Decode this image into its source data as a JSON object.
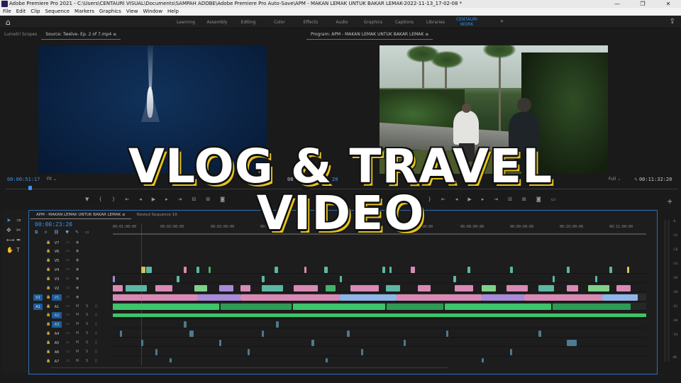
{
  "window": {
    "title": "Adobe Premiere Pro 2021 - C:\\Users\\CENTAURI VISUAL\\Documents\\SAMPAH ADOBE\\Adobe Premiere Pro Auto-Save\\APM - MAKAN LEMAK UNTUK BAKAR LEMAK-2022-11-13_17-02-08 *",
    "controls": [
      "—",
      "❐",
      "✕"
    ]
  },
  "menu": [
    "File",
    "Edit",
    "Clip",
    "Sequence",
    "Markers",
    "Graphics",
    "View",
    "Window",
    "Help"
  ],
  "workspaces": {
    "tabs": [
      "Learning",
      "Assembly",
      "Editing",
      "Color",
      "Effects",
      "Audio",
      "Graphics",
      "Captions",
      "Libraries",
      "CENTAURI WORK"
    ],
    "active": "CENTAURI WORK",
    "more": "»"
  },
  "source_monitor": {
    "tabs": [
      "Lumetri Scopes",
      "Source: Twelve- Ep. 2 of 7.mp4 ≡"
    ],
    "timecode": "00:00:51:17",
    "fit": "Fit",
    "right_tc_fragment": "08"
  },
  "program_monitor": {
    "tab": "Program: APM - MAKAN LEMAK UNTUK BAKAR LEMAK ≡",
    "timecode_fragment": "20",
    "fit": "Full",
    "duration": "00:11:32:20"
  },
  "timeline": {
    "tabs": [
      "APM - MAKAN LEMAK UNTUK BAKAR LEMAK ≡",
      "Nested Sequence 19"
    ],
    "timecode": "00:00:23:20",
    "ruler": [
      "00:01:00:00",
      "00:02:00:00",
      "00:03:00:00",
      "00:04:00:00",
      "00:07:00:00",
      "00:08:00:00",
      "00:09:00:00",
      "00:10:00:00",
      "00:11:00:00"
    ],
    "video_tracks": [
      "V7",
      "V6",
      "V5",
      "V4",
      "V3",
      "V2",
      "V1"
    ],
    "audio_tracks": [
      "A1",
      "A2",
      "A3",
      "A4",
      "A5",
      "A6",
      "A7"
    ],
    "source_patch_v": "V1",
    "source_patch_a": "A1",
    "ms": [
      "M",
      "S"
    ]
  },
  "meters": {
    "labels": [
      "-6",
      "-12",
      "-18",
      "-24",
      "-30",
      "-36",
      "-42",
      "-48",
      "-54",
      "dB"
    ]
  },
  "overlay": {
    "line1": "VLOG & TRAVEL",
    "line2": "VIDEO",
    "shadow_color": "#e6c21a"
  }
}
